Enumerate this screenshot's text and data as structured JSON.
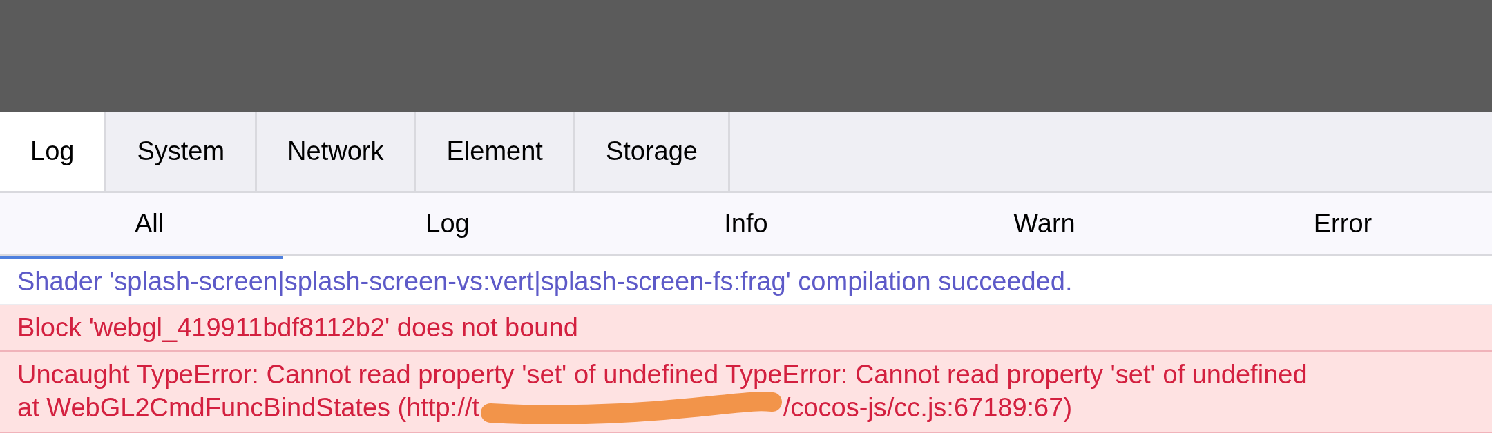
{
  "tabs": [
    {
      "label": "Log",
      "selected": true
    },
    {
      "label": "System",
      "selected": false
    },
    {
      "label": "Network",
      "selected": false
    },
    {
      "label": "Element",
      "selected": false
    },
    {
      "label": "Storage",
      "selected": false
    }
  ],
  "filters": [
    "All",
    "Log",
    "Info",
    "Warn",
    "Error"
  ],
  "log_entries": [
    {
      "kind": "info",
      "lines": [
        {
          "parts": [
            "Shader 'splash-screen|splash-screen-vs:vert|splash-screen-fs:frag' compilation succeeded."
          ],
          "redacted": false
        }
      ]
    },
    {
      "kind": "error",
      "lines": [
        {
          "parts": [
            "Block 'webgl_419911bdf8112b2' does not bound"
          ],
          "redacted": false
        }
      ]
    },
    {
      "kind": "error",
      "lines": [
        {
          "parts": [
            "Uncaught TypeError: Cannot read property 'set' of undefined TypeError: Cannot read property 'set' of undefined"
          ],
          "redacted": false
        },
        {
          "parts": [
            "at WebGL2CmdFuncBindStates (http://t",
            "/cocos-js/cc.js:67189:67)"
          ],
          "redacted": true
        }
      ]
    }
  ]
}
